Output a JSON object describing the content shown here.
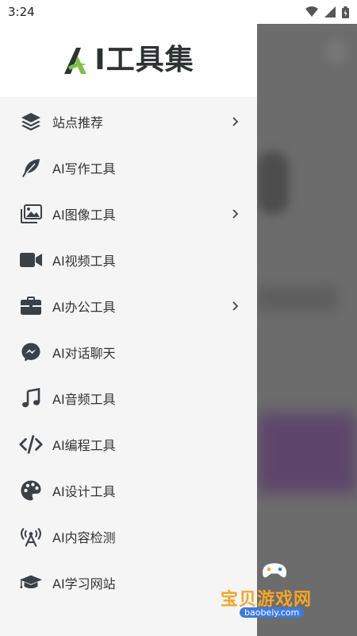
{
  "status_bar": {
    "time": "3:24"
  },
  "drawer": {
    "logo_text": "I工具集",
    "items": [
      {
        "label": "站点推荐",
        "icon": "layers-icon",
        "has_chevron": true
      },
      {
        "label": "AI写作工具",
        "icon": "feather-icon",
        "has_chevron": false
      },
      {
        "label": "AI图像工具",
        "icon": "images-icon",
        "has_chevron": true
      },
      {
        "label": "AI视频工具",
        "icon": "video-icon",
        "has_chevron": false
      },
      {
        "label": "AI办公工具",
        "icon": "briefcase-icon",
        "has_chevron": true
      },
      {
        "label": "AI对话聊天",
        "icon": "messenger-icon",
        "has_chevron": false
      },
      {
        "label": "AI音频工具",
        "icon": "music-note-icon",
        "has_chevron": false
      },
      {
        "label": "AI编程工具",
        "icon": "code-icon",
        "has_chevron": false
      },
      {
        "label": "AI设计工具",
        "icon": "palette-icon",
        "has_chevron": false
      },
      {
        "label": "AI内容检测",
        "icon": "broadcast-tower-icon",
        "has_chevron": false
      },
      {
        "label": "AI学习网站",
        "icon": "graduation-cap-icon",
        "has_chevron": false
      }
    ]
  },
  "watermark": {
    "text": "宝贝游戏网",
    "url": "baobeiy.com"
  },
  "colors": {
    "icon": "#3b4147",
    "brand_green": "#7cc242",
    "watermark_orange": "#f6a623"
  }
}
